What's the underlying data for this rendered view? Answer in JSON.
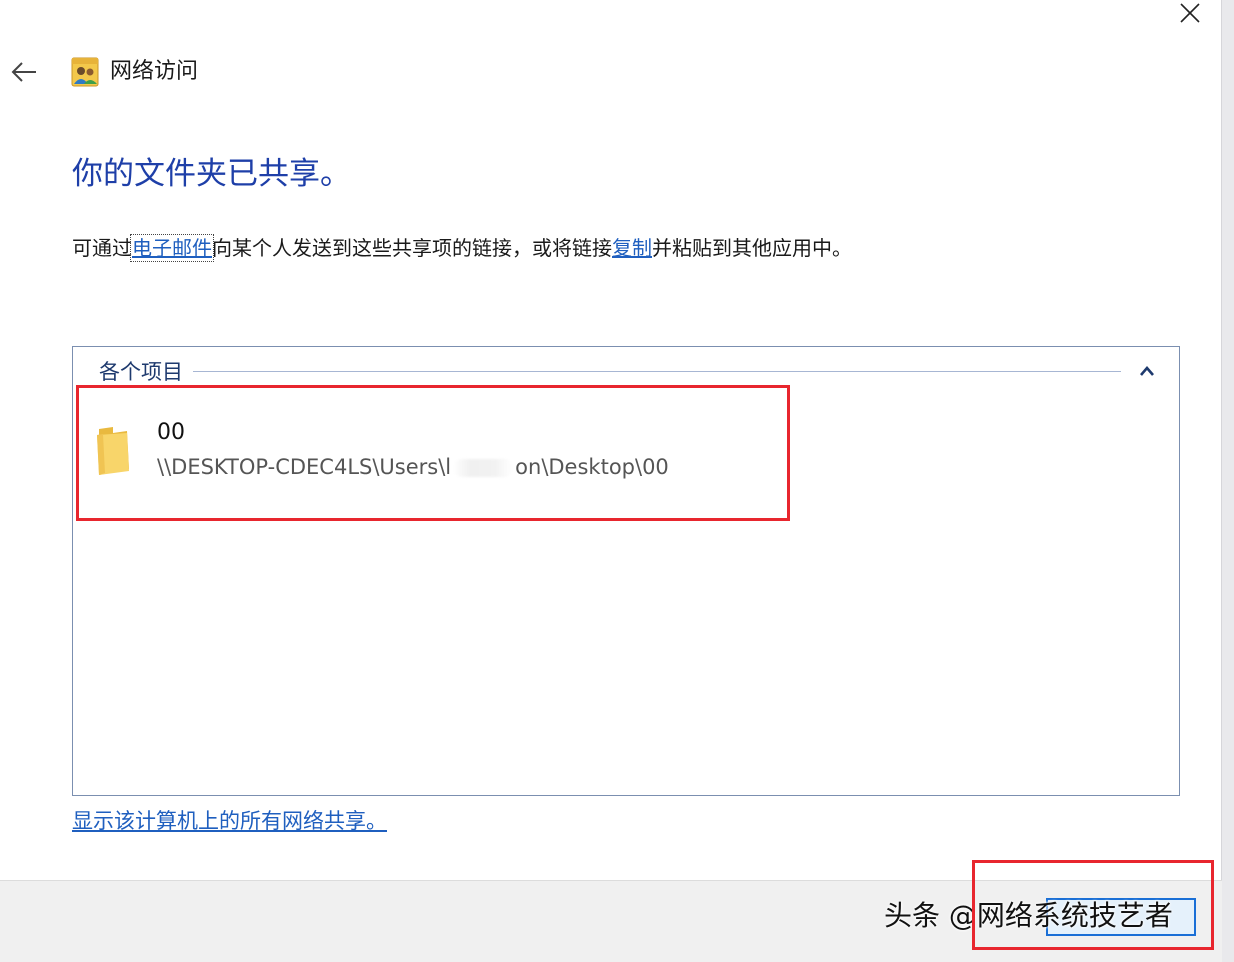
{
  "window": {
    "title": "网络访问"
  },
  "main": {
    "heading": "你的文件夹已共享。",
    "desc_pre": "可通过",
    "desc_email_link": "电子邮件",
    "desc_mid": "向某个人发送到这些共享项的链接，或将链接",
    "desc_copy_link": "复制",
    "desc_post": "并粘贴到其他应用中。"
  },
  "items_group": {
    "title": "各个项目",
    "items": [
      {
        "name": "00",
        "path_prefix": "\\\\DESKTOP-CDEC4LS\\Users\\l",
        "path_suffix": "on\\Desktop\\00"
      }
    ]
  },
  "share_link": "显示该计算机上的所有网络共享。",
  "watermark": "头条 @网络系统技艺者",
  "colors": {
    "heading": "#1e3fa8",
    "link": "#1f5fbf",
    "highlight": "#e8262e",
    "button_border": "#1a6fd6"
  },
  "icons": {
    "close": "close-icon",
    "back": "back-arrow-icon",
    "app": "network-users-icon",
    "collapse": "chevron-up-icon",
    "folder": "folder-icon"
  }
}
